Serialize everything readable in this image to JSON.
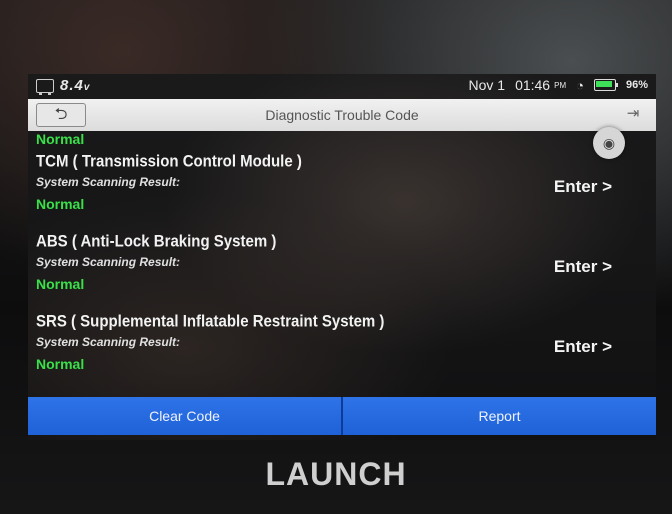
{
  "status": {
    "voltage": "8.4",
    "voltage_unit": "v",
    "date": "Nov 1",
    "time": "01:46",
    "ampm": "PM",
    "battery": "96%"
  },
  "titlebar": {
    "title": "Diagnostic Trouble Code"
  },
  "top_result": "Normal",
  "modules": [
    {
      "title": "TCM ( Transmission Control Module )",
      "sub": "System Scanning Result:",
      "result": "Normal",
      "enter": "Enter >"
    },
    {
      "title": "ABS ( Anti-Lock Braking System )",
      "sub": "System Scanning Result:",
      "result": "Normal",
      "enter": "Enter >"
    },
    {
      "title": "SRS ( Supplemental Inflatable Restraint System )",
      "sub": "System Scanning Result:",
      "result": "Normal",
      "enter": "Enter >"
    }
  ],
  "bottom": {
    "clear": "Clear Code",
    "report": "Report"
  },
  "brand": "LAUNCH",
  "colors": {
    "accent": "#2a6be2",
    "normal": "#39e048"
  },
  "icons": [
    "car-battery-icon",
    "wifi-icon",
    "battery-icon",
    "back-arrow-icon",
    "exit-icon",
    "camera-icon"
  ]
}
